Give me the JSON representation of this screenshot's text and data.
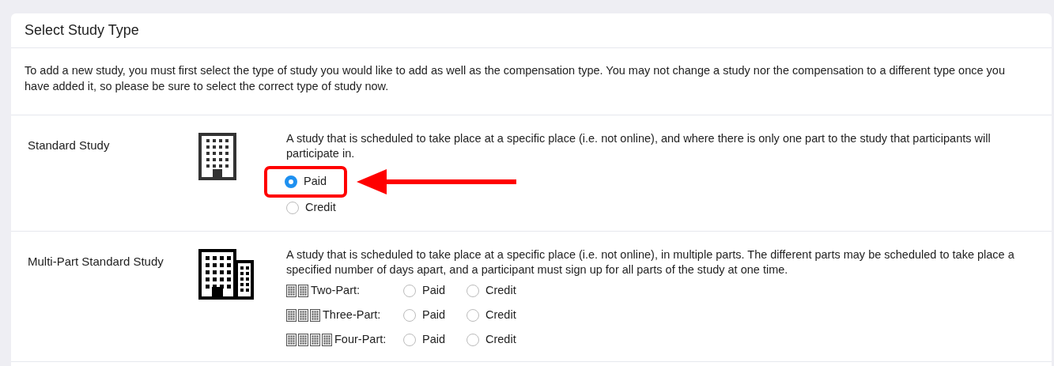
{
  "panel": {
    "title": "Select Study Type",
    "intro": "To add a new study, you must first select the type of study you would like to add as well as the compensation type. You may not change a study nor the compensation to a different type once you have added it, so please be sure to select the correct type of study now."
  },
  "study_types": [
    {
      "kind": "single",
      "name": "Standard Study",
      "description": "A study that is scheduled to take place at a specific place (i.e. not online), and where there is only one part to the study that participants will participate in.",
      "options": [
        {
          "label": "Paid",
          "selected": true,
          "highlighted": true
        },
        {
          "label": "Credit",
          "selected": false,
          "highlighted": false
        }
      ]
    },
    {
      "kind": "multi",
      "name": "Multi-Part Standard Study",
      "description": "A study that is scheduled to take place at a specific place (i.e. not online), in multiple parts. The different parts may be scheduled to take place a specified number of days apart, and a participant must sign up for all parts of the study at one time.",
      "parts": [
        {
          "label": "Two-Part:",
          "icons": [
            {
              "kind": "building"
            },
            {
              "kind": "building"
            }
          ],
          "options": [
            {
              "label": "Paid",
              "selected": false
            },
            {
              "label": "Credit",
              "selected": false
            }
          ]
        },
        {
          "label": "Three-Part:",
          "icons": [
            {
              "kind": "building"
            },
            {
              "kind": "building"
            },
            {
              "kind": "building"
            }
          ],
          "options": [
            {
              "label": "Paid",
              "selected": false
            },
            {
              "label": "Credit",
              "selected": false
            }
          ]
        },
        {
          "label": "Four-Part:",
          "icons": [
            {
              "kind": "building"
            },
            {
              "kind": "building"
            },
            {
              "kind": "building"
            },
            {
              "kind": "building"
            }
          ],
          "options": [
            {
              "label": "Paid",
              "selected": false
            },
            {
              "label": "Credit",
              "selected": false
            }
          ]
        }
      ]
    }
  ]
}
